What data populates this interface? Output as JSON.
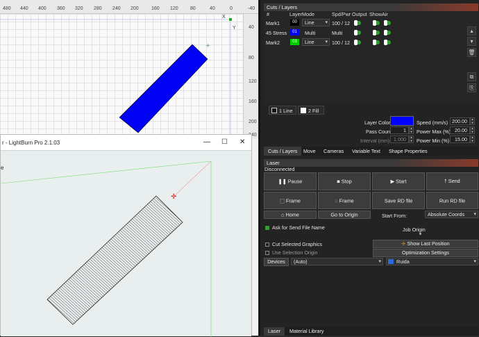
{
  "canvas": {
    "ruler_top": [
      "480",
      "440",
      "400",
      "360",
      "320",
      "280",
      "240",
      "200",
      "160",
      "120",
      "80",
      "40",
      "0",
      "-40"
    ],
    "ruler_right": [
      "40",
      "80",
      "120",
      "160",
      "200",
      "240"
    ],
    "axis_x": "X",
    "axis_y": "Y",
    "shape_color": "#0000f5"
  },
  "lightburn_window": {
    "title": "r - LightBurn Pro 2.1.03",
    "minimize": "—",
    "maximize": "☐",
    "close": "✕",
    "left_char": "e"
  },
  "cuts_layers": {
    "title": "Cuts / Layers",
    "headers": [
      "#",
      "Layer",
      "Mode",
      "Spd/Pwr",
      "Output",
      "Show",
      "Air"
    ],
    "rows": [
      {
        "name": "Mark1",
        "layer": "00",
        "layer_color": "#000000",
        "mode": "Line",
        "spd_pwr": "100 / 12",
        "mode_is_combo": true
      },
      {
        "name": "45 Stress",
        "layer": "01",
        "layer_color": "#0000ff",
        "mode": "Multi",
        "spd_pwr": "Multi",
        "mode_is_combo": false
      },
      {
        "name": "Mark2",
        "layer": "03",
        "layer_color": "#00cc00",
        "mode": "Line",
        "spd_pwr": "100 / 12",
        "mode_is_combo": true
      }
    ],
    "line_tab": "1 Line",
    "fill_tab": "2 Fill",
    "layer_color_label": "Layer Color",
    "layer_color_value": "#0000ff",
    "speed_label": "Speed (mm/s)",
    "speed_value": "200.00",
    "pass_count_label": "Pass Count",
    "pass_count_value": "1",
    "power_max_label": "Power Max (%)",
    "power_max_value": "20.00",
    "interval_label": "Interval (mm)",
    "interval_value": "1.000",
    "power_min_label": "Power Min (%)",
    "power_min_value": "15.00"
  },
  "tabs_top": [
    "Cuts / Layers",
    "Move",
    "Cameras",
    "Variable Text",
    "Shape Properties"
  ],
  "laser": {
    "title": "Laser",
    "status": "Disconnected",
    "pause": "Pause",
    "stop": "Stop",
    "start": "Start",
    "send": "Send",
    "frame1": "Frame",
    "frame2": "Frame",
    "save_rd": "Save RD file",
    "run_rd": "Run RD file",
    "home": "Home",
    "goto_origin": "Go to Origin",
    "start_from_label": "Start From:",
    "start_from_value": "Absolute Coords",
    "ask_send": "Ask for Send File Name",
    "job_origin": "Job Origin",
    "cut_selected": "Cut Selected Graphics",
    "use_selection_origin": "Use Selection Origin",
    "show_last_position": "Show Last Position",
    "optimization_settings": "Optimization Settings",
    "devices": "Devices",
    "device_value": "(Auto)",
    "controller_value": "Ruida"
  },
  "tabs_bottom": [
    "Laser",
    "Material Library"
  ]
}
